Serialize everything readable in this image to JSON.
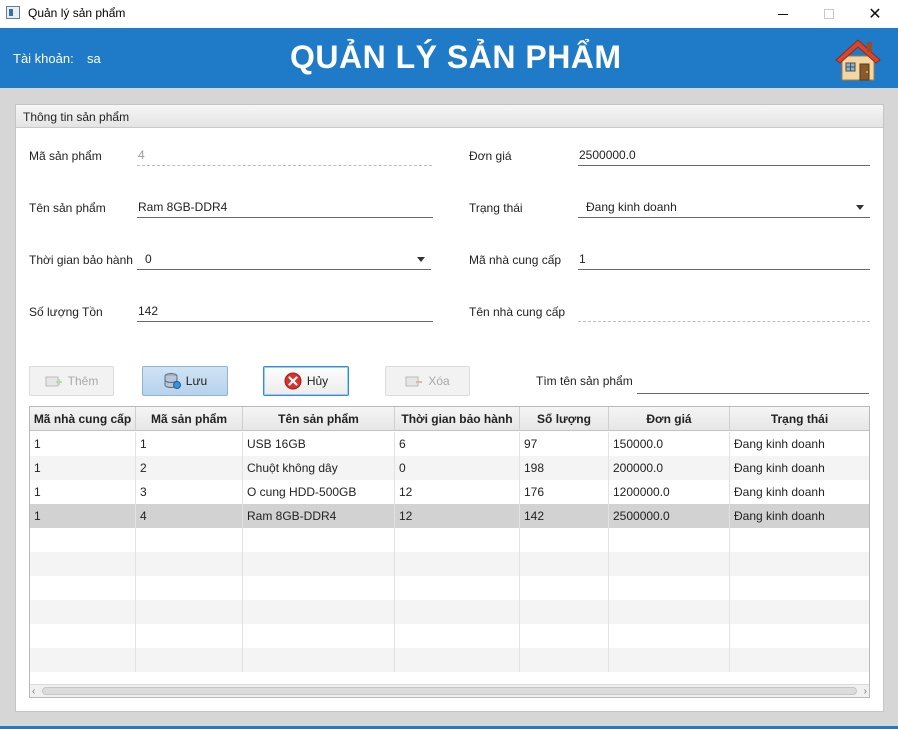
{
  "window": {
    "title": "Quản lý sản phẩm"
  },
  "header": {
    "account_label": "Tài khoản:",
    "account_value": "sa",
    "title": "QUẢN LÝ SẢN PHẨM"
  },
  "panel": {
    "title": "Thông tin sản phẩm"
  },
  "form": {
    "product_id_label": "Mã sản phẩm",
    "product_id_value": "4",
    "product_name_label": "Tên sản phẩm",
    "product_name_value": "Ram 8GB-DDR4",
    "warranty_label": "Thời gian bảo hành",
    "warranty_value": "0",
    "stock_label": "Số lượng Tồn",
    "stock_value": "142",
    "price_label": "Đơn giá",
    "price_value": "2500000.0",
    "status_label": "Trạng thái",
    "status_value": "Đang kinh doanh",
    "supplier_id_label": "Mã nhà cung cấp",
    "supplier_id_value": "1",
    "supplier_name_label": "Tên nhà cung cấp",
    "supplier_name_value": ""
  },
  "toolbar": {
    "add_label": "Thêm",
    "save_label": "Lưu",
    "cancel_label": "Hủy",
    "delete_label": "Xóa",
    "search_label": "Tìm tên sản phẩm",
    "search_value": ""
  },
  "table": {
    "columns": [
      "Mã nhà cung cấp",
      "Mã sản phẩm",
      "Tên sản phẩm",
      "Thời gian bảo hành",
      "Số lượng",
      "Đơn giá",
      "Trạng thái"
    ],
    "rows": [
      [
        "1",
        "1",
        "USB 16GB",
        "6",
        "97",
        "150000.0",
        "Đang kinh doanh"
      ],
      [
        "1",
        "2",
        "Chuột không dây",
        "0",
        "198",
        "200000.0",
        "Đang kinh doanh"
      ],
      [
        "1",
        "3",
        "O cung HDD-500GB",
        "12",
        "176",
        "1200000.0",
        "Đang kinh doanh"
      ],
      [
        "1",
        "4",
        "Ram 8GB-DDR4",
        "12",
        "142",
        "2500000.0",
        "Đang kinh doanh"
      ]
    ],
    "selected_row": 3
  },
  "colors": {
    "header_bg": "#1f7ac7",
    "body_bg": "#d6d6d6",
    "selected_row": "#d2d2d2",
    "cancel_icon": "#d9302c"
  },
  "icons": {
    "app": "app-window-icon",
    "home": "home-icon",
    "add": "add-icon",
    "save": "save-database-icon",
    "cancel": "cancel-circle-x-icon",
    "delete": "delete-icon"
  }
}
